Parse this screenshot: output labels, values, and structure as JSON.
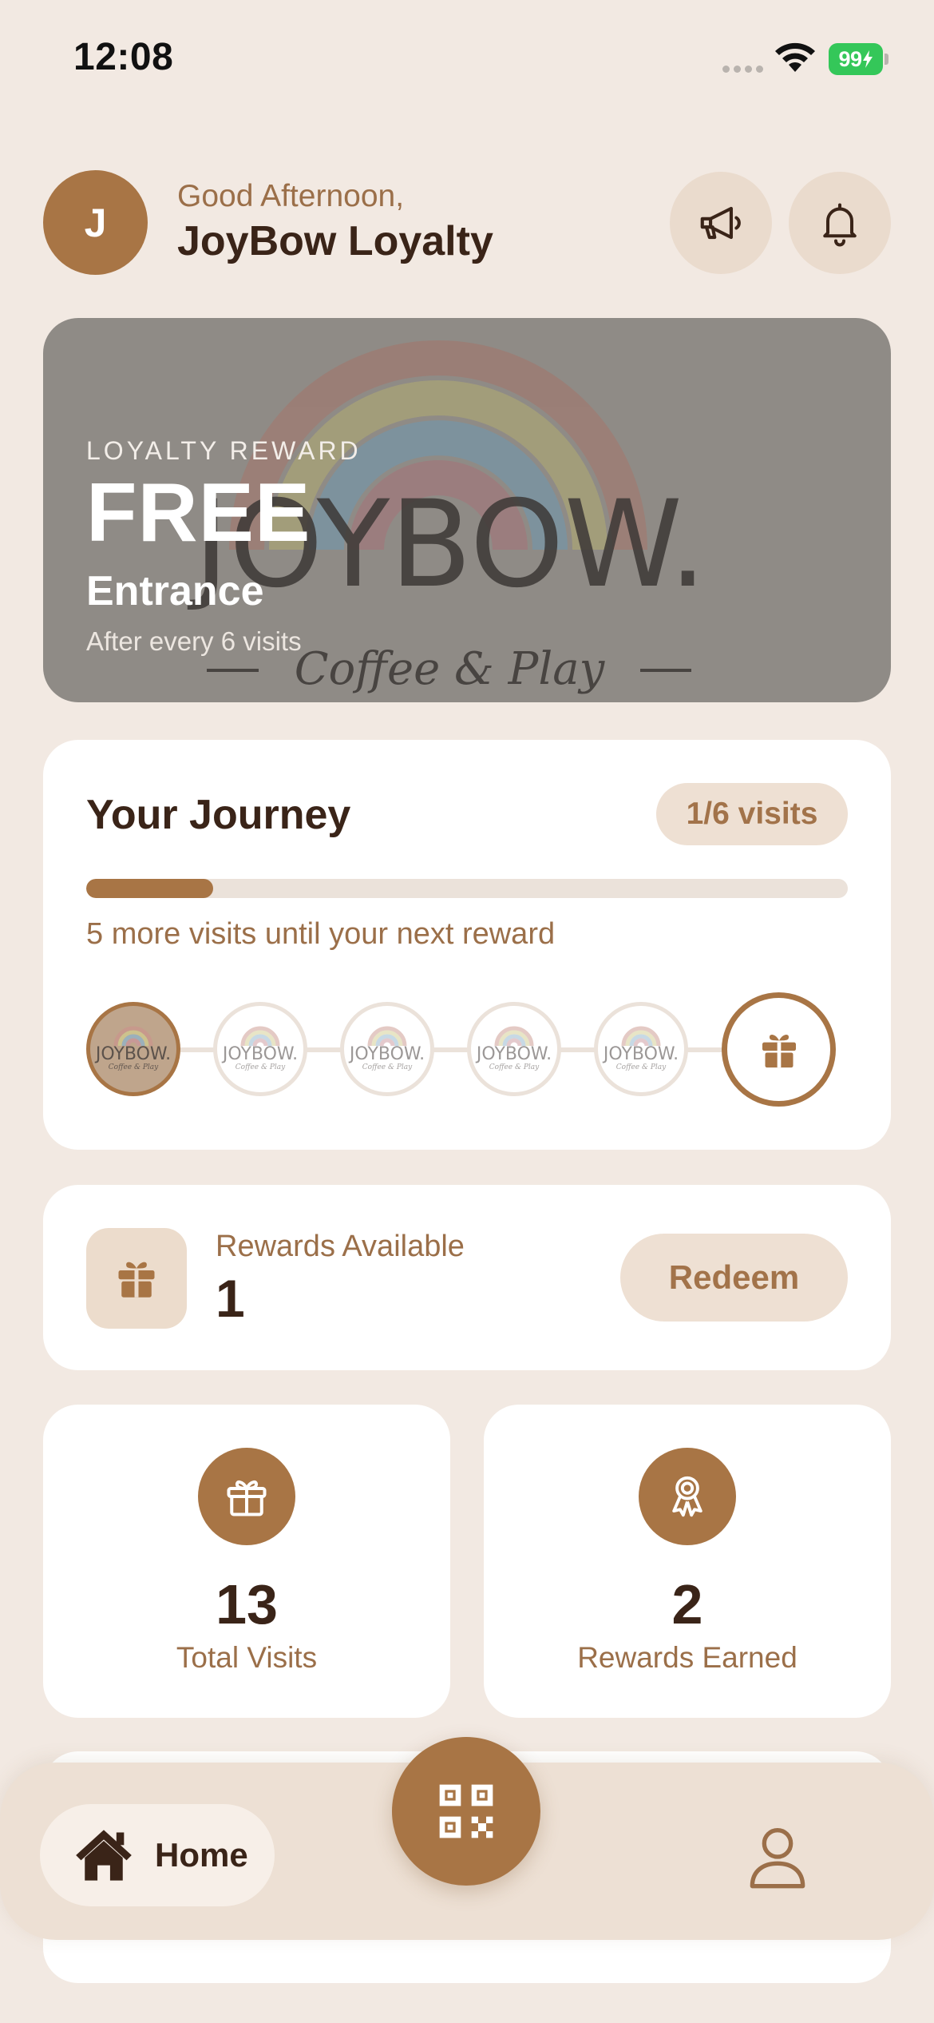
{
  "status_bar": {
    "time": "12:08",
    "battery": "99"
  },
  "header": {
    "avatar_initial": "J",
    "greeting": "Good Afternoon,",
    "name": "JoyBow Loyalty",
    "icons": [
      "megaphone-icon",
      "bell-icon"
    ]
  },
  "banner": {
    "eyebrow": "LOYALTY REWARD",
    "headline": "FREE",
    "subtitle": "Entrance",
    "note": "After every 6 visits",
    "logo_text": "JOYBOW.",
    "logo_tagline": "Coffee & Play"
  },
  "journey": {
    "title": "Your Journey",
    "badge": "1/6 visits",
    "progress_fraction": 0.1667,
    "progress_text": "5 more visits until your next reward",
    "stamps_total": 5,
    "stamps_filled": 1,
    "stamp_logo_text": "JOYBOW.",
    "stamp_logo_tagline": "Coffee & Play"
  },
  "rewards": {
    "label": "Rewards Available",
    "count": "1",
    "redeem_label": "Redeem"
  },
  "stats": {
    "visits_value": "13",
    "visits_label": "Total Visits",
    "earned_value": "2",
    "earned_label": "Rewards Earned"
  },
  "nav": {
    "home_label": "Home"
  },
  "colors": {
    "background": "#f2e9e2",
    "accent": "#a87545",
    "accent_soft": "#eee0d3",
    "text_dark": "#3a2418",
    "text_muted": "#9b6f49"
  }
}
